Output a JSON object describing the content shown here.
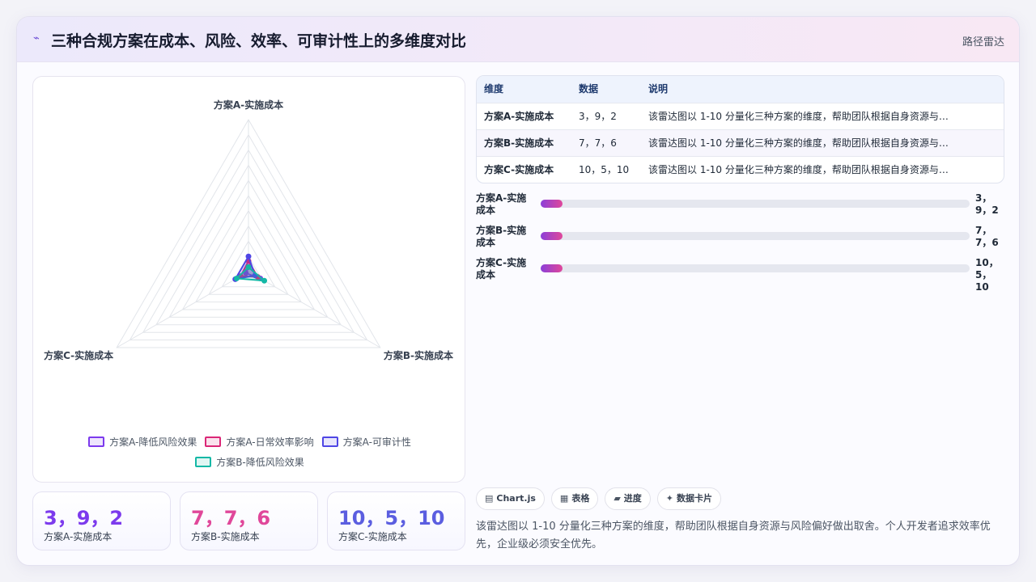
{
  "header": {
    "logo": "⌁",
    "title": "三种合规方案在成本、风险、效率、可审计性上的多维度对比",
    "tag": "路径雷达"
  },
  "chart_data": {
    "type": "radar",
    "axes": [
      "方案A-实施成本",
      "方案B-实施成本",
      "方案C-实施成本"
    ],
    "range": [
      0,
      100
    ],
    "rings": 10,
    "series": [
      {
        "name": "方案A-降低风险效果",
        "values": [
          3,
          9,
          2
        ],
        "color": "#7c3aed"
      },
      {
        "name": "方案A-日常效率影响",
        "values": [
          7,
          7,
          6
        ],
        "color": "#db2777"
      },
      {
        "name": "方案A-可审计性",
        "values": [
          10,
          5,
          10
        ],
        "color": "#4f46e5"
      },
      {
        "name": "方案B-降低风险效果",
        "values": [
          3,
          12,
          9
        ],
        "color": "#14b8a6"
      }
    ],
    "legend_position": "bottom"
  },
  "kpis": [
    {
      "value": "3，9，2",
      "label": "方案A-实施成本",
      "color": "#7c3aed"
    },
    {
      "value": "7，7，6",
      "label": "方案B-实施成本",
      "color": "#e0479a"
    },
    {
      "value": "10，5，10",
      "label": "方案C-实施成本",
      "color": "#5b5ee0"
    }
  ],
  "table": {
    "headers": [
      "维度",
      "数据",
      "说明"
    ],
    "rows": [
      [
        "方案A-实施成本",
        "3，9，2",
        "该雷达图以 1-10 分量化三种方案的维度，帮助团队根据自身资源与风..."
      ],
      [
        "方案B-实施成本",
        "7，7，6",
        "该雷达图以 1-10 分量化三种方案的维度，帮助团队根据自身资源与风..."
      ],
      [
        "方案C-实施成本",
        "10，5，10",
        "该雷达图以 1-10 分量化三种方案的维度，帮助团队根据自身资源与风..."
      ]
    ]
  },
  "progress": [
    {
      "label": "方案A-实施成本",
      "value": "3，9，2",
      "fill": 0.05
    },
    {
      "label": "方案B-实施成本",
      "value": "7，7，6",
      "fill": 0.05
    },
    {
      "label": "方案C-实施成本",
      "value": "10，5，10",
      "fill": 0.05
    }
  ],
  "chips": [
    {
      "icon": "▤",
      "label": "Chart.js"
    },
    {
      "icon": "▦",
      "label": "表格"
    },
    {
      "icon": "▰",
      "label": "进度"
    },
    {
      "icon": "✦",
      "label": "数据卡片"
    }
  ],
  "description": "该雷达图以 1-10 分量化三种方案的维度，帮助团队根据自身资源与风险偏好做出取舍。个人开发者追求效率优先，企业级必须安全优先。"
}
